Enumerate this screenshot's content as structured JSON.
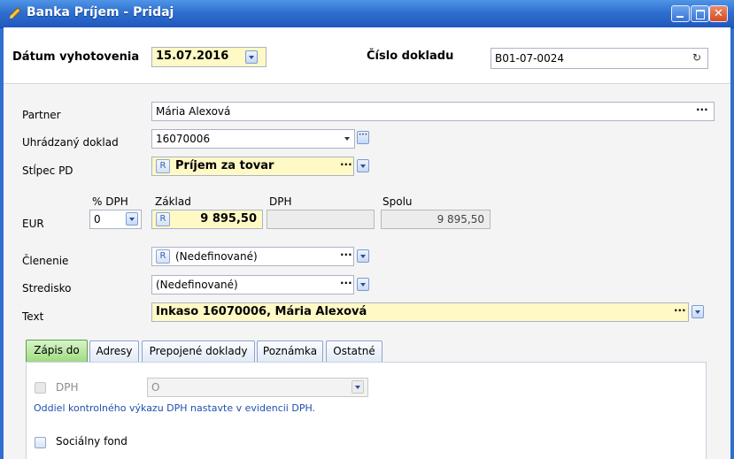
{
  "window": {
    "title": "Banka Príjem - Pridaj"
  },
  "header": {
    "date_label": "Dátum vyhotovenia",
    "date_value": "15.07.2016",
    "doc_number_label": "Číslo dokladu",
    "doc_number_value": "B01-07-0024"
  },
  "form": {
    "partner_label": "Partner",
    "partner_value": "Mária Alexová",
    "paid_doc_label": "Uhrádzaný doklad",
    "paid_doc_value": "16070006",
    "column_label": "Stĺpec PD",
    "column_value": "Príjem za tovar",
    "vat_pct_label": "% DPH",
    "base_label": "Základ",
    "vat_label": "DPH",
    "total_label": "Spolu",
    "currency_label": "EUR",
    "vat_pct_value": "0",
    "base_value": "9 895,50",
    "vat_value": "",
    "total_value": "9 895,50",
    "division_label": "Členenie",
    "division_value": "(Nedefinované)",
    "center_label": "Stredisko",
    "center_value": "(Nedefinované)",
    "text_label": "Text",
    "text_value": "Inkaso 16070006, Mária Alexová",
    "r_badge": "R",
    "dots": "···"
  },
  "tabs": [
    {
      "label": "Zápis do"
    },
    {
      "label": "Adresy"
    },
    {
      "label": "Prepojené doklady"
    },
    {
      "label": "Poznámka"
    },
    {
      "label": "Ostatné"
    }
  ],
  "tab_panel": {
    "vat_checkbox_label": "DPH",
    "vat_select_value": "O",
    "vat_note": "Oddiel kontrolného výkazu DPH nastavte v evidencii DPH.",
    "social_fund_label": "Sociálny fond"
  },
  "colors": {
    "title_bar": "#2f6fd0",
    "required_field": "#fff9c6",
    "active_tab": "#9fdb82",
    "note_text": "#1f4fb0"
  }
}
